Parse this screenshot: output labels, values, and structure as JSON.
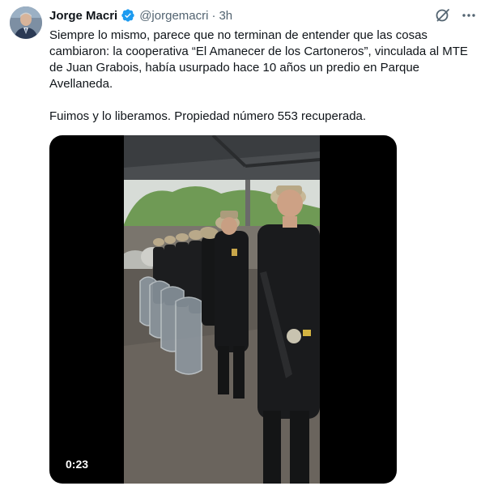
{
  "tweet": {
    "author_name": "Jorge Macri",
    "handle": "@jorgemacri",
    "separator": "·",
    "time": "3h",
    "text_paragraph_1": "Siempre lo mismo, parece que no terminan de entender que las cosas cambiaron: la cooperativa “El Amanecer de los Cartoneros”, vinculada al MTE de Juan Grabois, había usurpado hace 10 años un predio en Parque Avellaneda.",
    "text_paragraph_2": "Fuimos y lo liberamos. Propiedad número 553 recuperada.",
    "verified": true
  },
  "media": {
    "type": "video",
    "duration": "0:23"
  },
  "icons": {
    "grok": "grok-icon",
    "more": "more-icon",
    "verified": "verified-badge-icon"
  },
  "colors": {
    "verified_blue": "#1d9bf0",
    "secondary_text": "#536471",
    "primary_text": "#0f1419"
  }
}
